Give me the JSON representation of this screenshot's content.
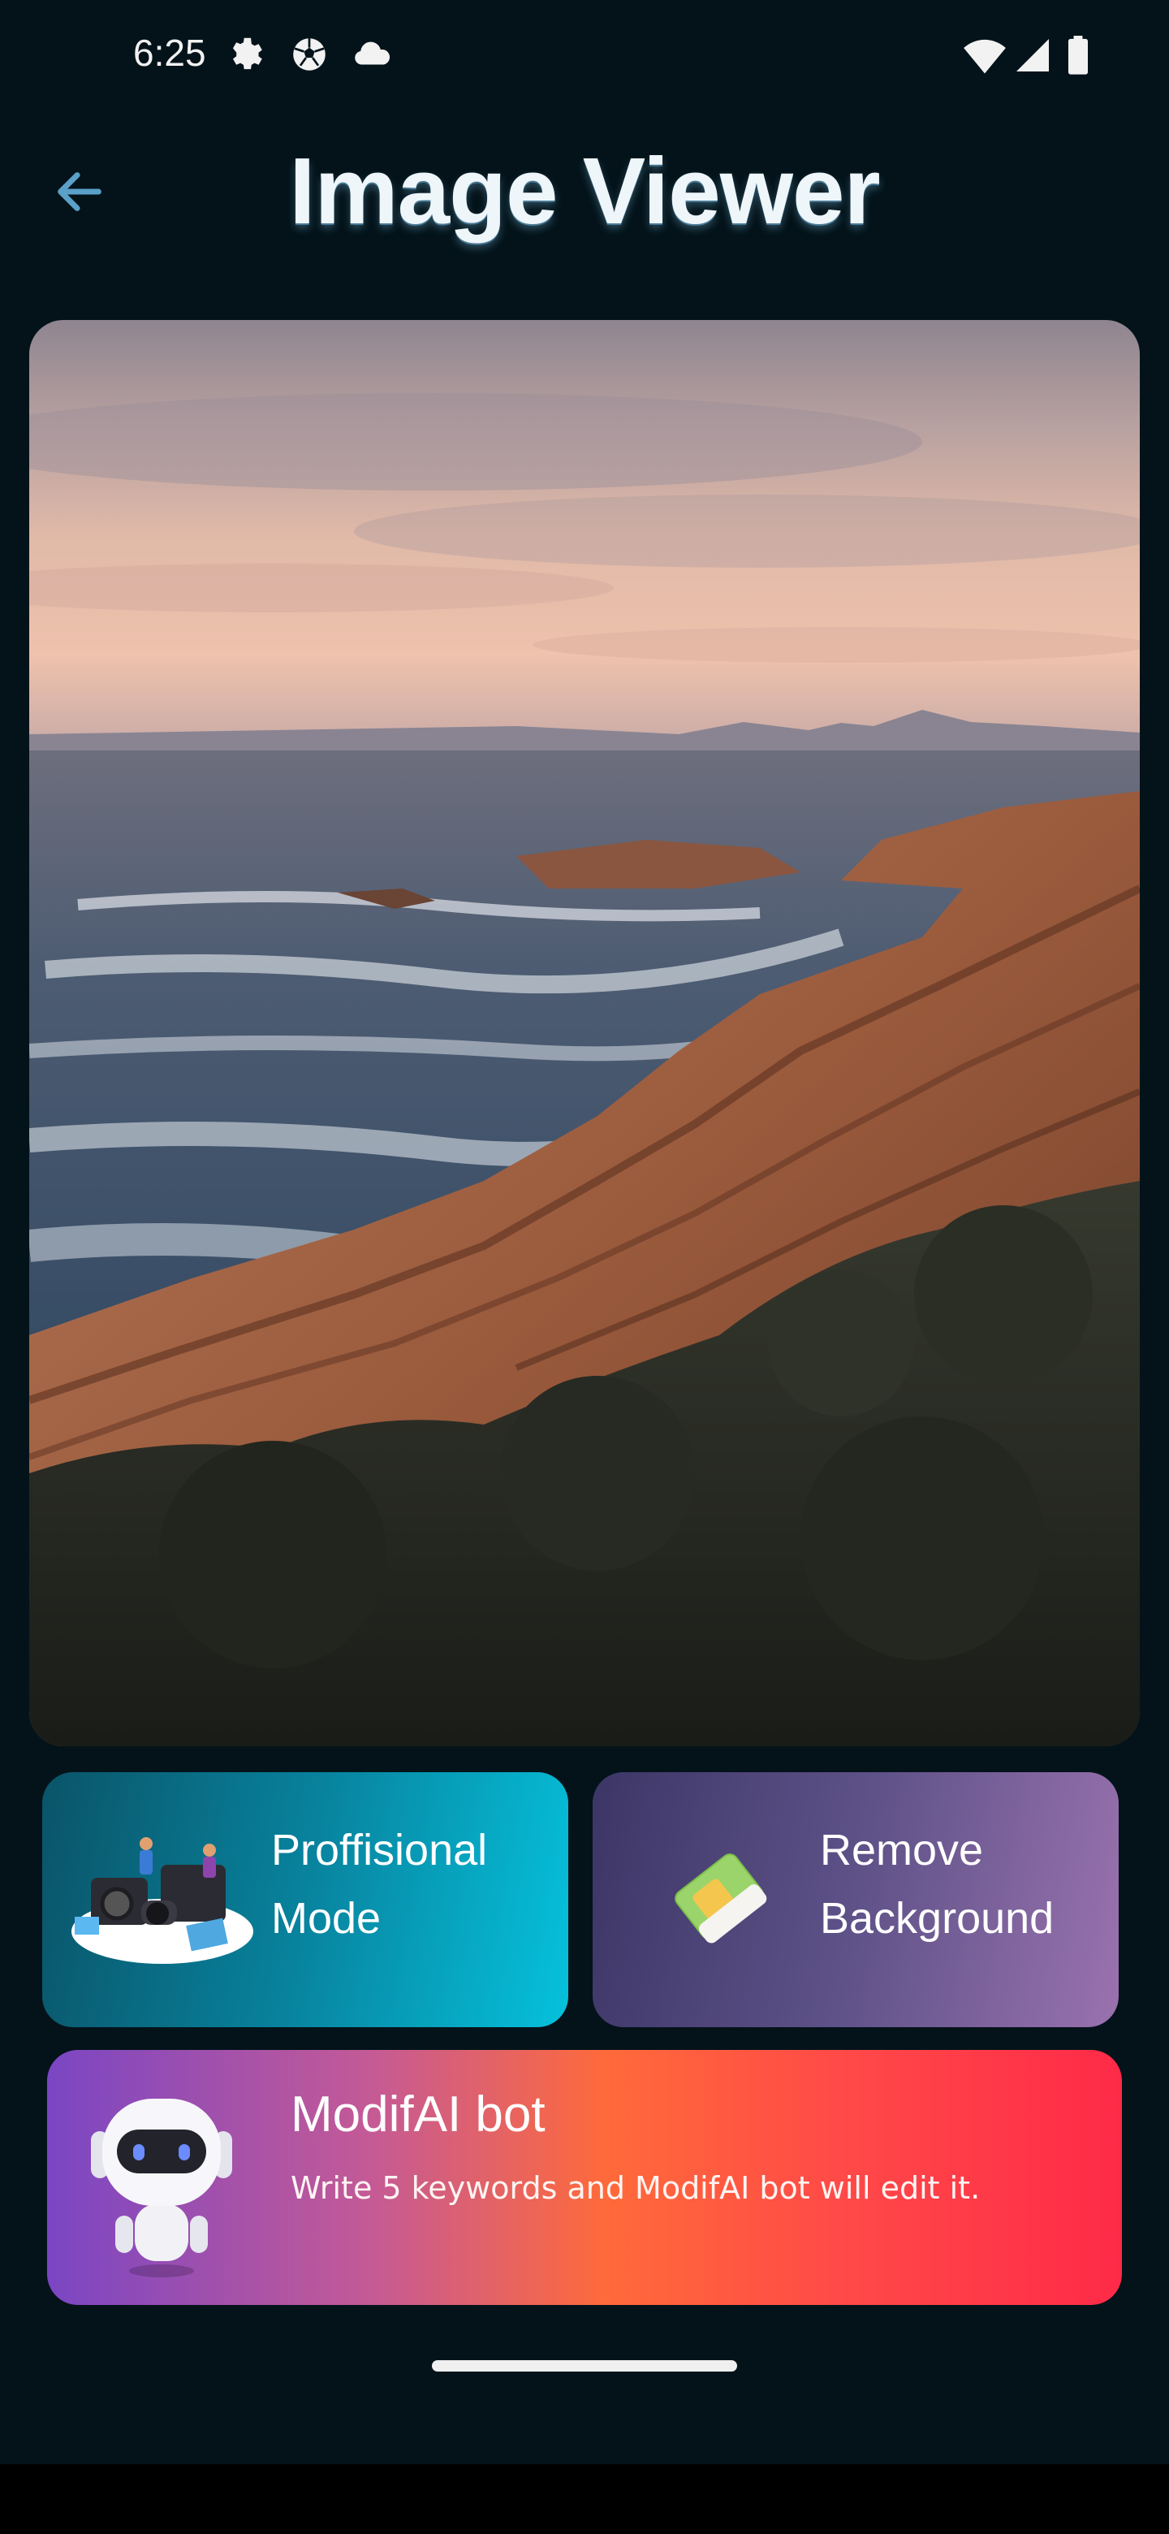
{
  "status_bar": {
    "time": "6:25",
    "left_icons": [
      "settings-gear-icon",
      "soccer-ball-icon",
      "cloud-icon"
    ],
    "right_icons": [
      "wifi-icon",
      "signal-icon",
      "battery-icon"
    ]
  },
  "header": {
    "back_icon": "arrow-left-icon",
    "title": "Image Viewer"
  },
  "image": {
    "subject": "coastal-rocks-sunset-photo"
  },
  "actions": {
    "professional": {
      "label_line1": "Proffisional",
      "label_line2": "Mode",
      "icon": "camera-illustration-icon"
    },
    "remove_bg": {
      "label_line1": "Remove",
      "label_line2": "Background",
      "icon": "eraser-icon"
    }
  },
  "bot": {
    "title": "ModifAI bot",
    "description": "Write 5 keywords and ModifAI bot will edit it.",
    "icon": "robot-icon"
  },
  "colors": {
    "background": "#04131a",
    "back_arrow": "#5aa0c8",
    "pro_gradient": [
      "#0a5468",
      "#06c1dc"
    ],
    "bg_gradient": [
      "#3c3666",
      "#9a72ae"
    ],
    "bot_gradient": [
      "#7a46c4",
      "#ff6a3a",
      "#ff2a48"
    ]
  }
}
